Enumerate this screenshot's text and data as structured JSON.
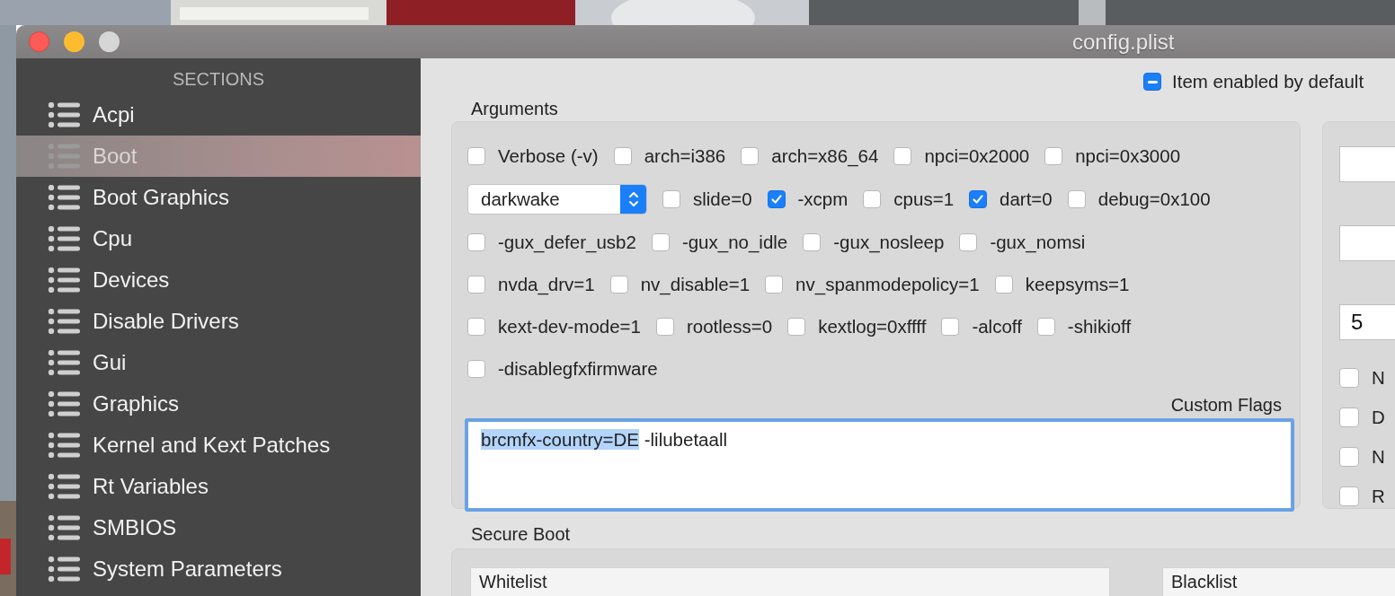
{
  "window": {
    "title": "config.plist"
  },
  "sidebar": {
    "header": "SECTIONS",
    "items": [
      {
        "label": "Acpi",
        "selected": false
      },
      {
        "label": "Boot",
        "selected": true
      },
      {
        "label": "Boot Graphics",
        "selected": false
      },
      {
        "label": "Cpu",
        "selected": false
      },
      {
        "label": "Devices",
        "selected": false
      },
      {
        "label": "Disable Drivers",
        "selected": false
      },
      {
        "label": "Gui",
        "selected": false
      },
      {
        "label": "Graphics",
        "selected": false
      },
      {
        "label": "Kernel and Kext Patches",
        "selected": false
      },
      {
        "label": "Rt Variables",
        "selected": false
      },
      {
        "label": "SMBIOS",
        "selected": false
      },
      {
        "label": "System Parameters",
        "selected": false
      }
    ]
  },
  "item_enabled": {
    "label": "Item enabled by default",
    "mixed": true
  },
  "arguments": {
    "title": "Arguments",
    "rows": [
      [
        {
          "kind": "checkbox",
          "label": "Verbose (-v)",
          "checked": false
        },
        {
          "kind": "checkbox",
          "label": "arch=i386",
          "checked": false
        },
        {
          "kind": "checkbox",
          "label": "arch=x86_64",
          "checked": false
        },
        {
          "kind": "checkbox",
          "label": "npci=0x2000",
          "checked": false
        },
        {
          "kind": "checkbox",
          "label": "npci=0x3000",
          "checked": false
        }
      ],
      [
        {
          "kind": "popup",
          "value": "darkwake"
        },
        {
          "kind": "checkbox",
          "label": "slide=0",
          "checked": false
        },
        {
          "kind": "checkbox",
          "label": "-xcpm",
          "checked": true
        },
        {
          "kind": "checkbox",
          "label": "cpus=1",
          "checked": false
        },
        {
          "kind": "checkbox",
          "label": "dart=0",
          "checked": true
        },
        {
          "kind": "checkbox",
          "label": "debug=0x100",
          "checked": false
        }
      ],
      [
        {
          "kind": "checkbox",
          "label": "-gux_defer_usb2",
          "checked": false
        },
        {
          "kind": "checkbox",
          "label": "-gux_no_idle",
          "checked": false
        },
        {
          "kind": "checkbox",
          "label": "-gux_nosleep",
          "checked": false
        },
        {
          "kind": "checkbox",
          "label": "-gux_nomsi",
          "checked": false
        }
      ],
      [
        {
          "kind": "checkbox",
          "label": "nvda_drv=1",
          "checked": false
        },
        {
          "kind": "checkbox",
          "label": "nv_disable=1",
          "checked": false
        },
        {
          "kind": "checkbox",
          "label": "nv_spanmodepolicy=1",
          "checked": false
        },
        {
          "kind": "checkbox",
          "label": "keepsyms=1",
          "checked": false
        }
      ],
      [
        {
          "kind": "checkbox",
          "label": "kext-dev-mode=1",
          "checked": false
        },
        {
          "kind": "checkbox",
          "label": "rootless=0",
          "checked": false
        },
        {
          "kind": "checkbox",
          "label": "kextlog=0xffff",
          "checked": false
        },
        {
          "kind": "checkbox",
          "label": "-alcoff",
          "checked": false
        },
        {
          "kind": "checkbox",
          "label": "-shikioff",
          "checked": false
        }
      ],
      [
        {
          "kind": "checkbox",
          "label": "-disablegfxfirmware",
          "checked": false
        }
      ]
    ],
    "custom_flags": {
      "label": "Custom Flags",
      "value_parts": [
        {
          "text": "brcmfx-country=DE",
          "selected": true
        },
        {
          "text": "-lilubetaall",
          "selected": false
        }
      ]
    }
  },
  "right_panel": {
    "fields": [
      {
        "kind": "text"
      },
      {
        "kind": "text"
      },
      {
        "kind": "text",
        "value": "5"
      }
    ],
    "checkboxes": [
      {
        "label": "N",
        "checked": false
      },
      {
        "label": "D",
        "checked": false
      },
      {
        "label": "N",
        "checked": false
      },
      {
        "label": "R",
        "checked": false
      }
    ]
  },
  "secure_boot": {
    "title": "Secure Boot",
    "lists": [
      {
        "header": "Whitelist"
      },
      {
        "header": "Blacklist"
      }
    ]
  }
}
